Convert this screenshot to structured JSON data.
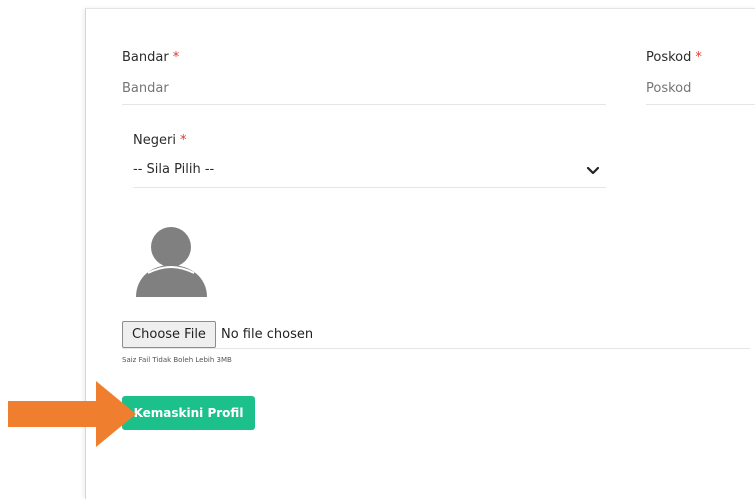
{
  "form": {
    "bandar": {
      "label": "Bandar",
      "required_mark": "*",
      "placeholder": "Bandar"
    },
    "poskod": {
      "label": "Poskod",
      "required_mark": "*",
      "placeholder": "Poskod"
    },
    "negeri": {
      "label": "Negeri",
      "required_mark": "*",
      "selected": "-- Sila Pilih --"
    },
    "photo": {
      "button_label": "Choose File",
      "status": "No file chosen",
      "hint": "Saiz Fail Tidak Boleh Lebih 3MB"
    },
    "submit_label": "Kemaskini Profil"
  },
  "colors": {
    "accent": "#1cc08a",
    "required": "#e2352b",
    "arrow": "#ef7f2f",
    "avatar": "#808080"
  }
}
